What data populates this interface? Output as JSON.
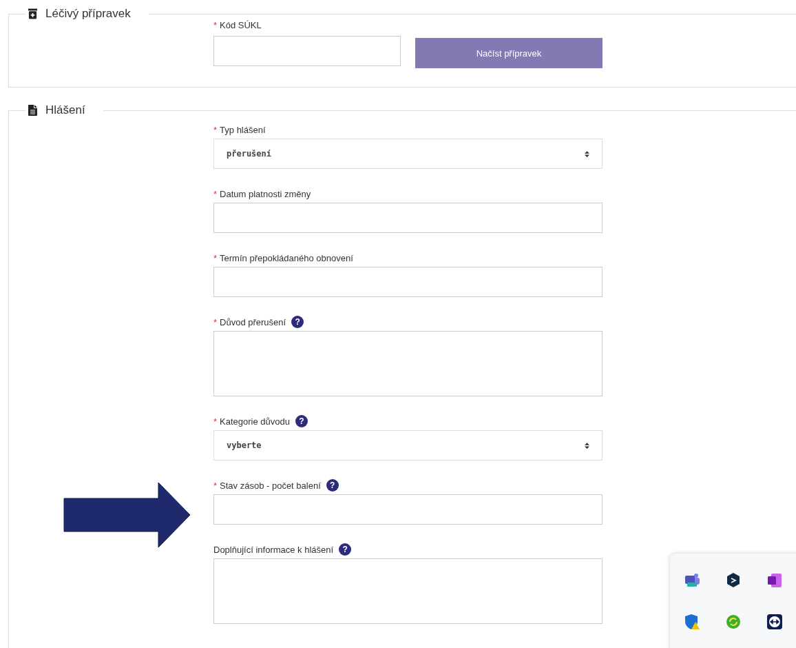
{
  "sections": [
    {
      "title": "Léčivý přípravek",
      "kind": "medicine",
      "fields": [
        {
          "kind": "input",
          "required_mark": "*",
          "label": "Kód SÚKL",
          "button": "Načíst přípravek"
        }
      ]
    },
    {
      "title": "Hlášení",
      "kind": "document",
      "fields": [
        {
          "kind": "select",
          "required_mark": "*",
          "label": "Typ hlášení",
          "value": "přerušení"
        },
        {
          "kind": "input",
          "required_mark": "*",
          "label": "Datum platnosti změny"
        },
        {
          "kind": "input",
          "required_mark": "*",
          "label": "Termín přepokládaného obnovení"
        },
        {
          "kind": "textarea",
          "required_mark": "*",
          "label": "Důvod přerušení",
          "help": "?"
        },
        {
          "kind": "select",
          "required_mark": "*",
          "label": "Kategorie důvodu",
          "help": "?",
          "value": "vyberte"
        },
        {
          "kind": "input",
          "required_mark": "*",
          "label": "Stav zásob - počet balení",
          "help": "?"
        },
        {
          "kind": "textarea",
          "label": "Doplňující informace k hlášení",
          "help": "?"
        }
      ]
    }
  ],
  "tray_icons": [
    {
      "kind": "teams"
    },
    {
      "kind": "hex"
    },
    {
      "kind": "onenote"
    },
    {
      "kind": "shield"
    },
    {
      "kind": "sync"
    },
    {
      "kind": "remote"
    }
  ]
}
